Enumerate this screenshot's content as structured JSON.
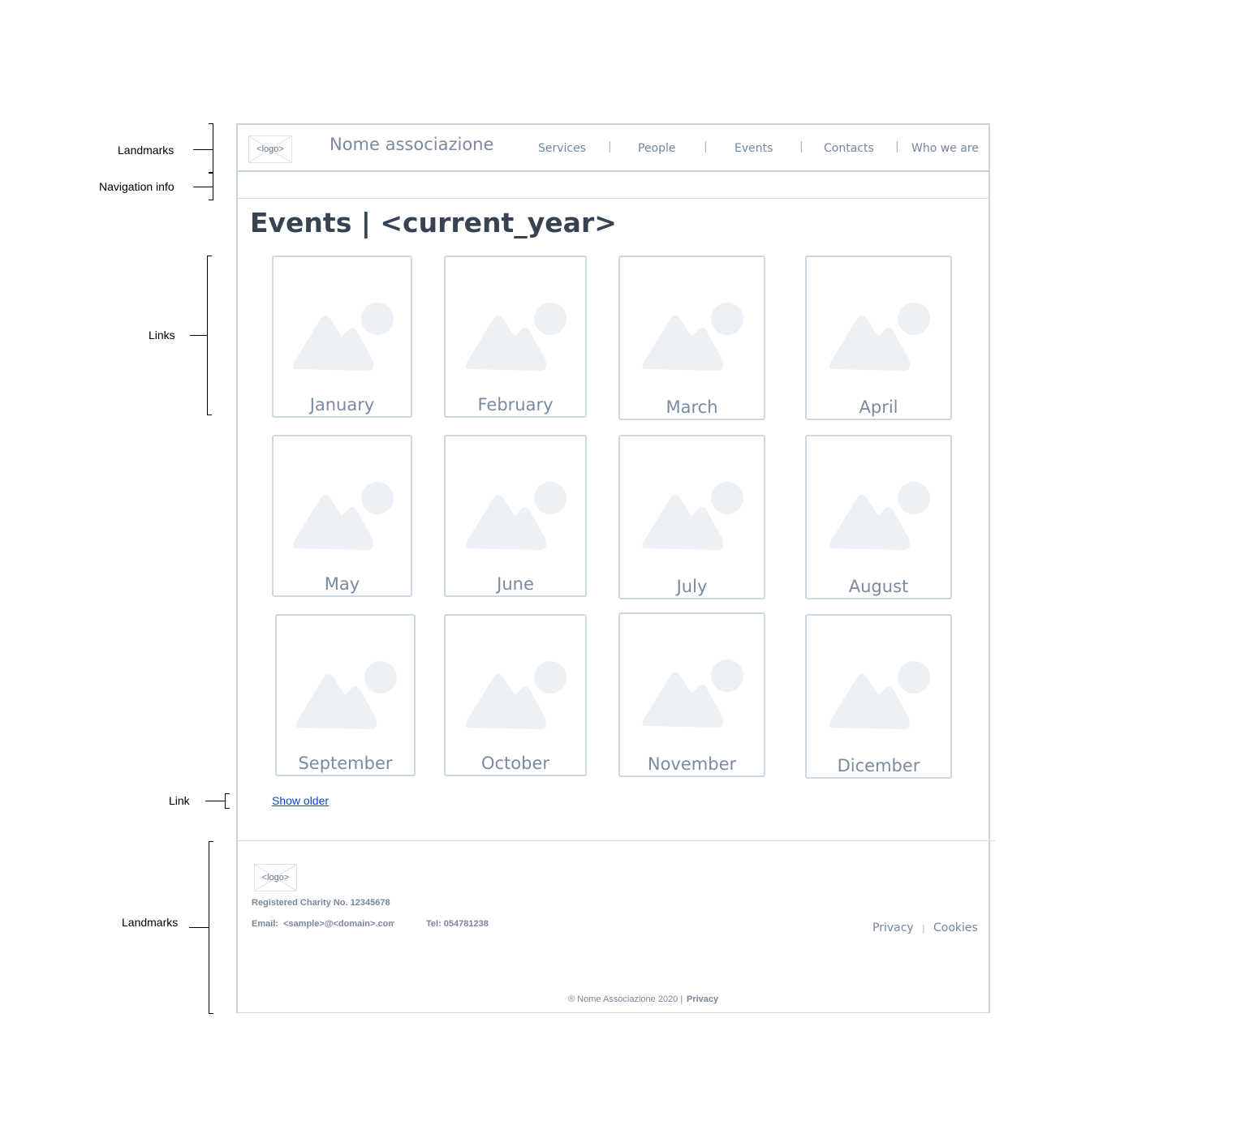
{
  "annotations": {
    "landmarks_top": "Landmarks",
    "navigation_info": "Navigation info",
    "links": "Links",
    "link": "Link",
    "landmarks_bottom": "Landmarks"
  },
  "header": {
    "logo": "<logo>",
    "brand": "Nome associazione",
    "nav": [
      "Services",
      "People",
      "Events",
      "Contacts",
      "Who we are"
    ],
    "separator": "|"
  },
  "page_title": "Events | <current_year>",
  "months": [
    "January",
    "February",
    "March",
    "April",
    "May",
    "June",
    "July",
    "August",
    "September",
    "October",
    "November",
    "Dicember"
  ],
  "show_older": "Show older",
  "footer": {
    "logo": "<logo>",
    "charity": "Registered Charity No. 12345678",
    "email_label": "Email:",
    "email": "<sample>@<domain>.com",
    "tel": "Tel: 054781238",
    "links": [
      "Privacy",
      "Cookies"
    ],
    "separator": "|",
    "copyright": "® Nome Associazione 2020 |",
    "copyright_link": "Privacy"
  },
  "colors": {
    "text": "#74869e",
    "heading": "#374353",
    "border": "#c9d3de",
    "placeholder": "#edf0f4",
    "link": "#0645d8"
  }
}
